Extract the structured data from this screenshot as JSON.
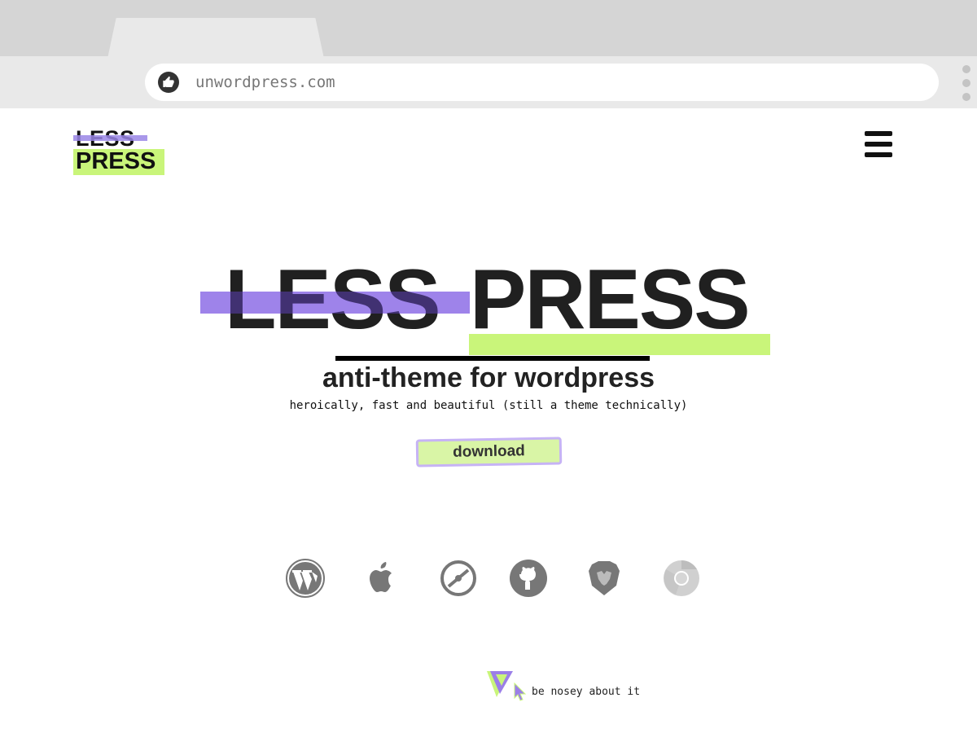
{
  "browser": {
    "url": "unwordpress.com",
    "site_icon": "thumbs-up-icon"
  },
  "header": {
    "logo_less": "LESS",
    "logo_press": "PRESS",
    "menu_icon": "hamburger-menu-icon"
  },
  "hero": {
    "less": "LESS",
    "press": "PRESS",
    "tagline": "anti-theme for wordpress",
    "subline": "heroically, fast and beautiful (still a theme technically)",
    "download_label": "download"
  },
  "icons": [
    "wordpress-icon",
    "apple-icon",
    "brave-alt-icon",
    "github-icon",
    "brave-lion-icon",
    "chrome-icon"
  ],
  "footer": {
    "hint": "be nosey about it"
  },
  "colors": {
    "accent_green": "#c9f57a",
    "accent_purple": "#c8b4f9",
    "text_dark": "#202020"
  }
}
